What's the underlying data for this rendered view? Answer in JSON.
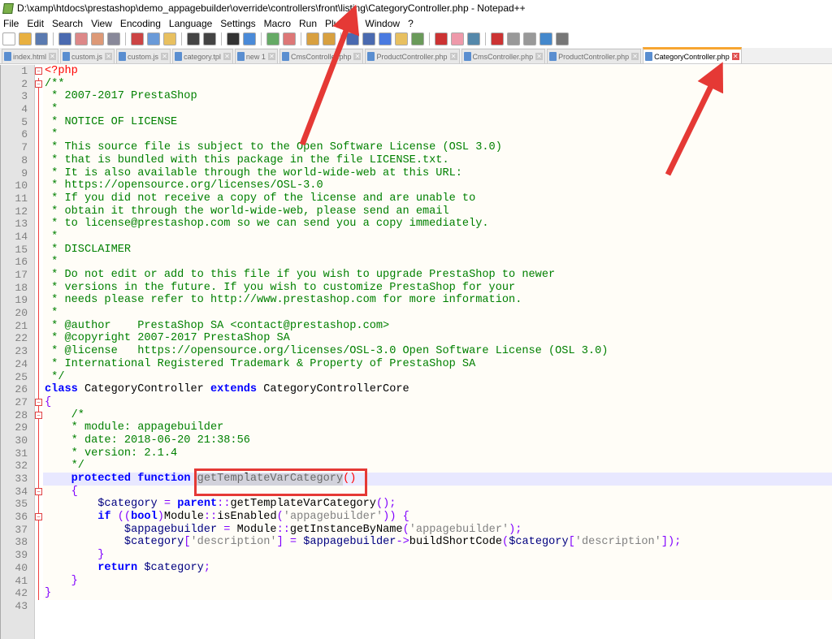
{
  "window": {
    "title": "D:\\xamp\\htdocs\\prestashop\\demo_appagebuilder\\override\\controllers\\front\\listing\\CategoryController.php - Notepad++"
  },
  "menu": [
    "File",
    "Edit",
    "Search",
    "View",
    "Encoding",
    "Language",
    "Settings",
    "Macro",
    "Run",
    "Plugins",
    "Window",
    "?"
  ],
  "toolbar_icons": [
    "new",
    "open",
    "save",
    "save-all",
    "close",
    "close-all",
    "print",
    "cut",
    "copy",
    "paste",
    "undo",
    "redo",
    "find",
    "replace",
    "zoom-in",
    "zoom-out",
    "sync-v",
    "sync-h",
    "word-wrap",
    "show-all",
    "indent-guide",
    "udl",
    "doc-map",
    "function-list",
    "folder",
    "monitor",
    "record",
    "stop",
    "play",
    "run-multiple",
    "save-macro"
  ],
  "tabs": [
    {
      "label": "index.html",
      "active": false
    },
    {
      "label": "custom.js",
      "active": false
    },
    {
      "label": "custom.js",
      "active": false
    },
    {
      "label": "category.tpl",
      "active": false
    },
    {
      "label": "new 1",
      "active": false
    },
    {
      "label": "CmsController.php",
      "active": false
    },
    {
      "label": "ProductController.php",
      "active": false
    },
    {
      "label": "CmsController.php",
      "active": false
    },
    {
      "label": "ProductController.php",
      "active": false
    },
    {
      "label": "CategoryController.php",
      "active": true
    }
  ],
  "colors": {
    "annotation": "#e53935",
    "active_tab_accent": "#f7a530",
    "current_line": "#e8e8ff"
  },
  "code": {
    "current_line": 33,
    "lines": [
      [
        [
          "t",
          "<?php"
        ]
      ],
      [
        [
          "c",
          "/**"
        ]
      ],
      [
        [
          "c",
          " * 2007-2017 PrestaShop"
        ]
      ],
      [
        [
          "c",
          " *"
        ]
      ],
      [
        [
          "c",
          " * NOTICE OF LICENSE"
        ]
      ],
      [
        [
          "c",
          " *"
        ]
      ],
      [
        [
          "c",
          " * This source file is subject to the Open Software License (OSL 3.0)"
        ]
      ],
      [
        [
          "c",
          " * that is bundled with this package in the file LICENSE.txt."
        ]
      ],
      [
        [
          "c",
          " * It is also available through the world-wide-web at this URL:"
        ]
      ],
      [
        [
          "c",
          " * https://opensource.org/licenses/OSL-3.0"
        ]
      ],
      [
        [
          "c",
          " * If you did not receive a copy of the license and are unable to"
        ]
      ],
      [
        [
          "c",
          " * obtain it through the world-wide-web, please send an email"
        ]
      ],
      [
        [
          "c",
          " * to license@prestashop.com so we can send you a copy immediately."
        ]
      ],
      [
        [
          "c",
          " *"
        ]
      ],
      [
        [
          "c",
          " * DISCLAIMER"
        ]
      ],
      [
        [
          "c",
          " *"
        ]
      ],
      [
        [
          "c",
          " * Do not edit or add to this file if you wish to upgrade PrestaShop to newer"
        ]
      ],
      [
        [
          "c",
          " * versions in the future. If you wish to customize PrestaShop for your"
        ]
      ],
      [
        [
          "c",
          " * needs please refer to http://www.prestashop.com for more information."
        ]
      ],
      [
        [
          "c",
          " *"
        ]
      ],
      [
        [
          "c",
          " * @author    PrestaShop SA <contact@prestashop.com>"
        ]
      ],
      [
        [
          "c",
          " * @copyright 2007-2017 PrestaShop SA"
        ]
      ],
      [
        [
          "c",
          " * @license   https://opensource.org/licenses/OSL-3.0 Open Software License (OSL 3.0)"
        ]
      ],
      [
        [
          "c",
          " * International Registered Trademark & Property of PrestaShop SA"
        ]
      ],
      [
        [
          "c",
          " */"
        ]
      ],
      [
        [
          "k",
          "class"
        ],
        [
          "d",
          " CategoryController "
        ],
        [
          "k",
          "extends"
        ],
        [
          "d",
          " CategoryControllerCore"
        ]
      ],
      [
        [
          "o",
          "{"
        ]
      ],
      [
        [
          "c",
          "    /*"
        ]
      ],
      [
        [
          "c",
          "    * module: appagebuilder"
        ]
      ],
      [
        [
          "c",
          "    * date: 2018-06-20 21:38:56"
        ]
      ],
      [
        [
          "c",
          "    * version: 2.1.4"
        ]
      ],
      [
        [
          "c",
          "    */"
        ]
      ],
      [
        [
          "d",
          "    "
        ],
        [
          "k",
          "protected"
        ],
        [
          "d",
          " "
        ],
        [
          "k",
          "function"
        ],
        [
          "d",
          " getTemplateVarCategory"
        ],
        [
          "t",
          "()"
        ]
      ],
      [
        [
          "o",
          "    {"
        ]
      ],
      [
        [
          "d",
          "        "
        ],
        [
          "v",
          "$category"
        ],
        [
          "d",
          " "
        ],
        [
          "o",
          "="
        ],
        [
          "d",
          " "
        ],
        [
          "k",
          "parent"
        ],
        [
          "o",
          "::"
        ],
        [
          "d",
          "getTemplateVarCategory"
        ],
        [
          "o",
          "();"
        ]
      ],
      [
        [
          "d",
          "        "
        ],
        [
          "k",
          "if"
        ],
        [
          "d",
          " "
        ],
        [
          "o",
          "(("
        ],
        [
          "k",
          "bool"
        ],
        [
          "o",
          ")"
        ],
        [
          "d",
          "Module"
        ],
        [
          "o",
          "::"
        ],
        [
          "d",
          "isEnabled"
        ],
        [
          "o",
          "("
        ],
        [
          "s",
          "'appagebuilder'"
        ],
        [
          "o",
          "))"
        ],
        [
          "d",
          " "
        ],
        [
          "o",
          "{"
        ]
      ],
      [
        [
          "d",
          "            "
        ],
        [
          "v",
          "$appagebuilder"
        ],
        [
          "d",
          " "
        ],
        [
          "o",
          "="
        ],
        [
          "d",
          " Module"
        ],
        [
          "o",
          "::"
        ],
        [
          "d",
          "getInstanceByName"
        ],
        [
          "o",
          "("
        ],
        [
          "s",
          "'appagebuilder'"
        ],
        [
          "o",
          ");"
        ]
      ],
      [
        [
          "d",
          "            "
        ],
        [
          "v",
          "$category"
        ],
        [
          "o",
          "["
        ],
        [
          "s",
          "'description'"
        ],
        [
          "o",
          "]"
        ],
        [
          "d",
          " "
        ],
        [
          "o",
          "="
        ],
        [
          "d",
          " "
        ],
        [
          "v",
          "$appagebuilder"
        ],
        [
          "o",
          "->"
        ],
        [
          "d",
          "buildShortCode"
        ],
        [
          "o",
          "("
        ],
        [
          "v",
          "$category"
        ],
        [
          "o",
          "["
        ],
        [
          "s",
          "'description'"
        ],
        [
          "o",
          "]);"
        ]
      ],
      [
        [
          "o",
          "        }"
        ]
      ],
      [
        [
          "d",
          "        "
        ],
        [
          "k",
          "return"
        ],
        [
          "d",
          " "
        ],
        [
          "v",
          "$category"
        ],
        [
          "o",
          ";"
        ]
      ],
      [
        [
          "o",
          "    }"
        ]
      ],
      [
        [
          "o",
          "}"
        ]
      ],
      []
    ]
  }
}
